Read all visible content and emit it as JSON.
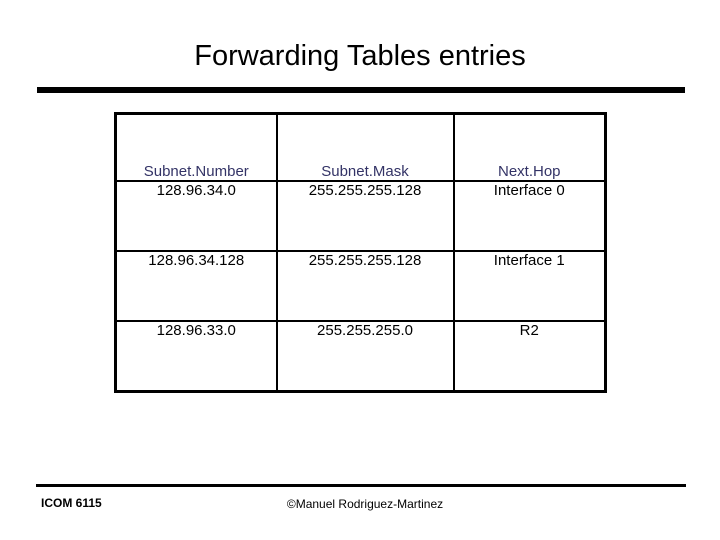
{
  "slide": {
    "title": "Forwarding Tables entries",
    "accent_color": "#000000",
    "header_text_color": "#333366",
    "body_text_color": "#000000",
    "background_color": "#ffffff"
  },
  "table": {
    "columns": [
      {
        "label": "Subnet.Number"
      },
      {
        "label": "Subnet.Mask"
      },
      {
        "label": "Next.Hop"
      }
    ],
    "rows": [
      {
        "subnet_number": "128.96.34.0",
        "subnet_mask": "255.255.255.128",
        "next_hop": "Interface 0"
      },
      {
        "subnet_number": "128.96.34.128",
        "subnet_mask": "255.255.255.128",
        "next_hop": "Interface 1"
      },
      {
        "subnet_number": "128.96.33.0",
        "subnet_mask": "255.255.255.0",
        "next_hop": "R2"
      }
    ]
  },
  "footer": {
    "course": "ICOM 6115",
    "copyright": "©Manuel Rodriguez-Martinez"
  }
}
